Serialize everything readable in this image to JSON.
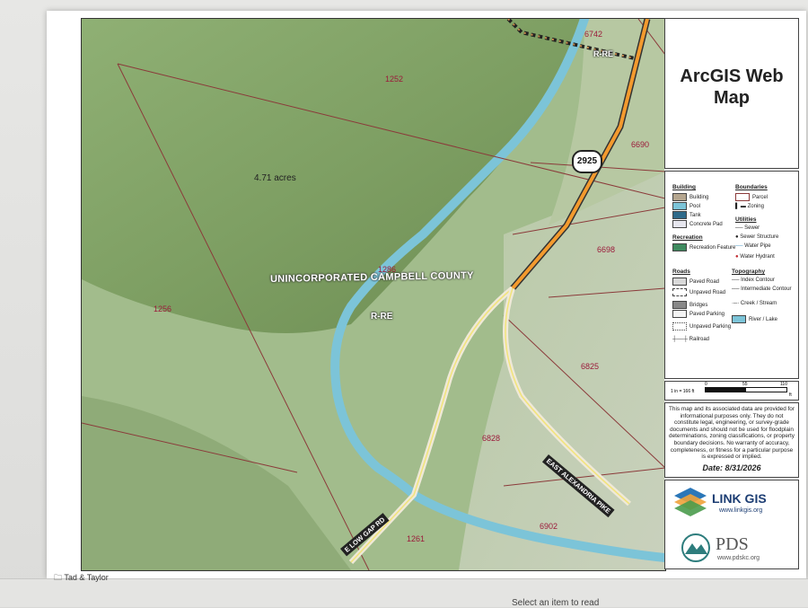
{
  "map": {
    "county_label": "UNINCORPORATED CAMPBELL COUNTY",
    "zoning_label": "R-RE",
    "zoning_label_top": "R-RE",
    "acreage_label": "4.71 acres",
    "route_shield": "2925",
    "road_east_alexandria": "EAST ALEXANDRIA PIKE",
    "road_low_gap": "E LOW GAP RD",
    "parcel_ids": {
      "p1252": "1252",
      "p1256": "1256",
      "p1286": "1286",
      "p1261": "1261",
      "p6742": "6742",
      "p6690": "6690",
      "p6698": "6698",
      "p6825": "6825",
      "p6828": "6828",
      "p6902": "6902"
    },
    "colors": {
      "terrain": "#9cb883",
      "creek": "#7cc4d8",
      "parcel_line": "#8b3a3a",
      "state_route": "#f39a2e",
      "local_road": "#f2e47a"
    }
  },
  "panel": {
    "title": "ArcGIS Web Map",
    "legend": {
      "building_header": "Building",
      "building": "Building",
      "pool": "Pool",
      "tank": "Tank",
      "concrete_pad": "Concrete Pad",
      "boundaries_header": "Boundaries",
      "parcel": "Parcel",
      "zoning": "Zoning",
      "utilities_header": "Utilities",
      "sewer": "Sewer",
      "sewer_structure": "Sewer Structure",
      "water_pipe": "Water Pipe",
      "water_hydrant": "Water Hydrant",
      "recreation_header": "Recreation",
      "recreation_feature": "Recreation Feature",
      "roads_header": "Roads",
      "paved_road": "Paved Road",
      "unpaved_road": "Unpaved Road",
      "bridges": "Bridges",
      "paved_parking": "Paved Parking",
      "unpaved_parking": "Unpaved Parking",
      "railroad": "Railroad",
      "topography_header": "Topography",
      "index_contour": "Index Contour",
      "intermediate_contour": "Intermediate Contour",
      "creek_stream": "Creek / Stream",
      "river_lake": "River / Lake"
    },
    "scale": {
      "ratio": "1 in = 166 ft",
      "ticks": [
        "0",
        "55",
        "110"
      ],
      "unit": "ft"
    },
    "disclaimer": "This map and its associated data are provided for informational purposes only. They do not constitute legal, engineering, or survey-grade documents and should not be used for floodplain determinations, zoning classifications, or property boundary decisions. No warranty of accuracy, completeness, or fitness for a particular purpose is expressed or implied.",
    "date": "Date: 8/31/2026",
    "linkgis_name": "LINK GIS",
    "linkgis_url": "www.linkgis.org",
    "pds_name": "PDS",
    "pds_url": "www.pdskc.org"
  },
  "desktop": {
    "folder_label": "Tad & Taylor",
    "status_text": "Select an item to read"
  }
}
